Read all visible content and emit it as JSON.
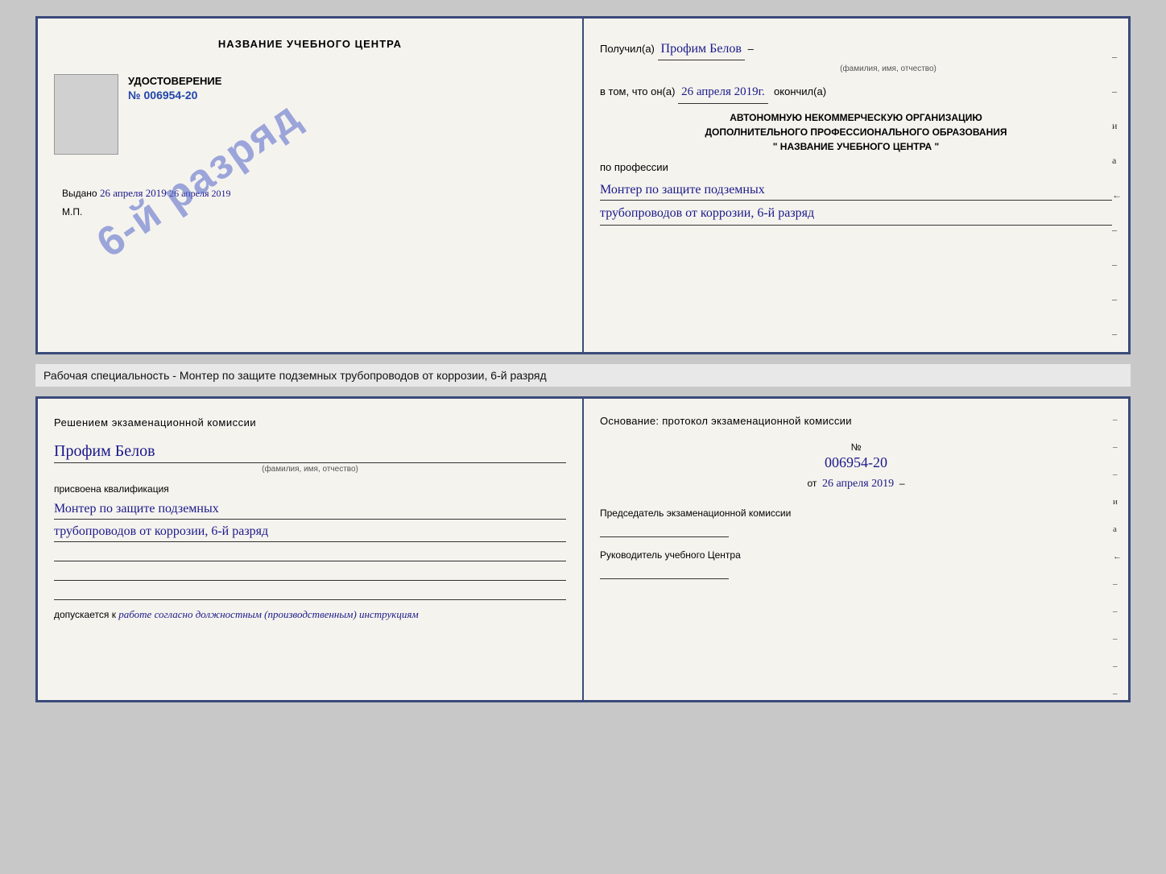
{
  "doc": {
    "top": {
      "left": {
        "title": "НАЗВАНИЕ УЧЕБНОГО ЦЕНТРА",
        "photo_alt": "photo",
        "subtitle": "УДОСТОВЕРЕНИЕ",
        "number": "№ 006954-20",
        "stamp": "6-й разряд",
        "issued_label": "Выдано",
        "issued_date": "26 апреля 2019",
        "mp": "М.П."
      },
      "right": {
        "received_label": "Получил(а)",
        "name_handwritten": "Профим Белов",
        "name_sublabel": "(фамилия, имя, отчество)",
        "dash": "–",
        "in_that_label": "в том, что он(а)",
        "date_handwritten": "26 апреля 2019г.",
        "finished_label": "окончил(а)",
        "org_line1": "АВТОНОМНУЮ НЕКОММЕРЧЕСКУЮ ОРГАНИЗАЦИЮ",
        "org_line2": "ДОПОЛНИТЕЛЬНОГО ПРОФЕССИОНАЛЬНОГО ОБРАЗОВАНИЯ",
        "org_line3": "\"    НАЗВАНИЕ УЧЕБНОГО ЦЕНТРА    \"",
        "profession_label": "по профессии",
        "profession_line1": "Монтер по защите подземных",
        "profession_line2": "трубопроводов от коррозии, 6-й разряд",
        "side_chars": [
          "–",
          "–",
          "и",
          "а",
          "←",
          "–",
          "–",
          "–",
          "–"
        ]
      }
    },
    "info_strip": "Рабочая специальность - Монтер по защите подземных трубопроводов от коррозии, 6-й разряд",
    "bottom": {
      "left": {
        "section_title": "Решением экзаменационной комиссии",
        "name_handwritten": "Профим Белов",
        "name_sublabel": "(фамилия, имя, отчество)",
        "assigned_label": "присвоена квалификация",
        "qual_line1": "Монтер по защите подземных",
        "qual_line2": "трубопроводов от коррозии, 6-й разряд",
        "blank_lines": 3,
        "admit_label": "допускается к",
        "admit_handwritten": "работе согласно должностным (производственным) инструкциям"
      },
      "right": {
        "basis_title": "Основание: протокол экзаменационной комиссии",
        "protocol_label": "№",
        "protocol_value": "006954-20",
        "date_prefix": "от",
        "date_value": "26 апреля 2019",
        "chairman_label": "Председатель экзаменационной комиссии",
        "director_label": "Руководитель учебного Центра",
        "side_chars": [
          "–",
          "–",
          "–",
          "и",
          "а",
          "←",
          "–",
          "–",
          "–",
          "–",
          "–"
        ]
      }
    }
  }
}
